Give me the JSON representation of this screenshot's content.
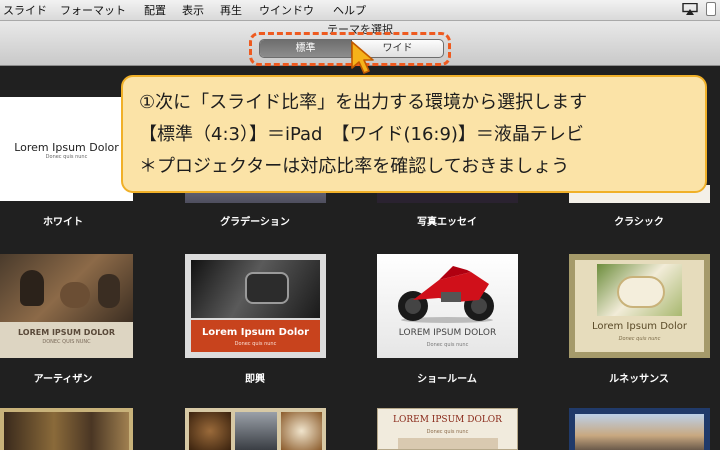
{
  "menubar": {
    "items": [
      "スライド",
      "フォーマット",
      "配置",
      "表示",
      "再生",
      "ウインドウ",
      "ヘルプ"
    ]
  },
  "window": {
    "title": "テーマを選択"
  },
  "aspect_toggle": {
    "standard": "標準",
    "wide": "ワイド",
    "selected": "標準"
  },
  "callout": {
    "line1": "①次に「スライド比率」を出力する環境から選択します",
    "line2": "【標準（4:3）】＝iPad　【ワイド(16:9)】＝液晶テレビ",
    "line3": "＊プロジェクターは対応比率を確認しておきましょう"
  },
  "themes": [
    {
      "name": "ホワイト",
      "preview_title": "Lorem Ipsum Dolor",
      "preview_subtitle": "Donec quis nunc"
    },
    {
      "name": "グラデーション"
    },
    {
      "name": "写真エッセイ"
    },
    {
      "name": "クラシック"
    },
    {
      "name": "アーティザン",
      "preview_title": "LOREM IPSUM DOLOR",
      "preview_subtitle": "DONEC QUIS NUNC"
    },
    {
      "name": "即興",
      "preview_title": "Lorem Ipsum Dolor",
      "preview_subtitle": "Donec quis nunc"
    },
    {
      "name": "ショールーム",
      "preview_title": "LOREM IPSUM DOLOR",
      "preview_subtitle": "Donec quis nunc"
    },
    {
      "name": "ルネッサンス",
      "preview_title": "Lorem Ipsum Dolor",
      "preview_subtitle": "Donec quis nunc"
    },
    {
      "name": ""
    },
    {
      "name": ""
    },
    {
      "name": "",
      "preview_title": "LOREM IPSUM DOLOR",
      "preview_subtitle": "Donec quis nunc"
    },
    {
      "name": ""
    }
  ],
  "colors": {
    "highlight": "#ee5a1f",
    "callout_fill": "#fbe3a7",
    "callout_border": "#f0b028",
    "background": "#202020"
  },
  "icons": [
    "airplay-icon",
    "document-icon",
    "pointer-cursor-icon"
  ]
}
